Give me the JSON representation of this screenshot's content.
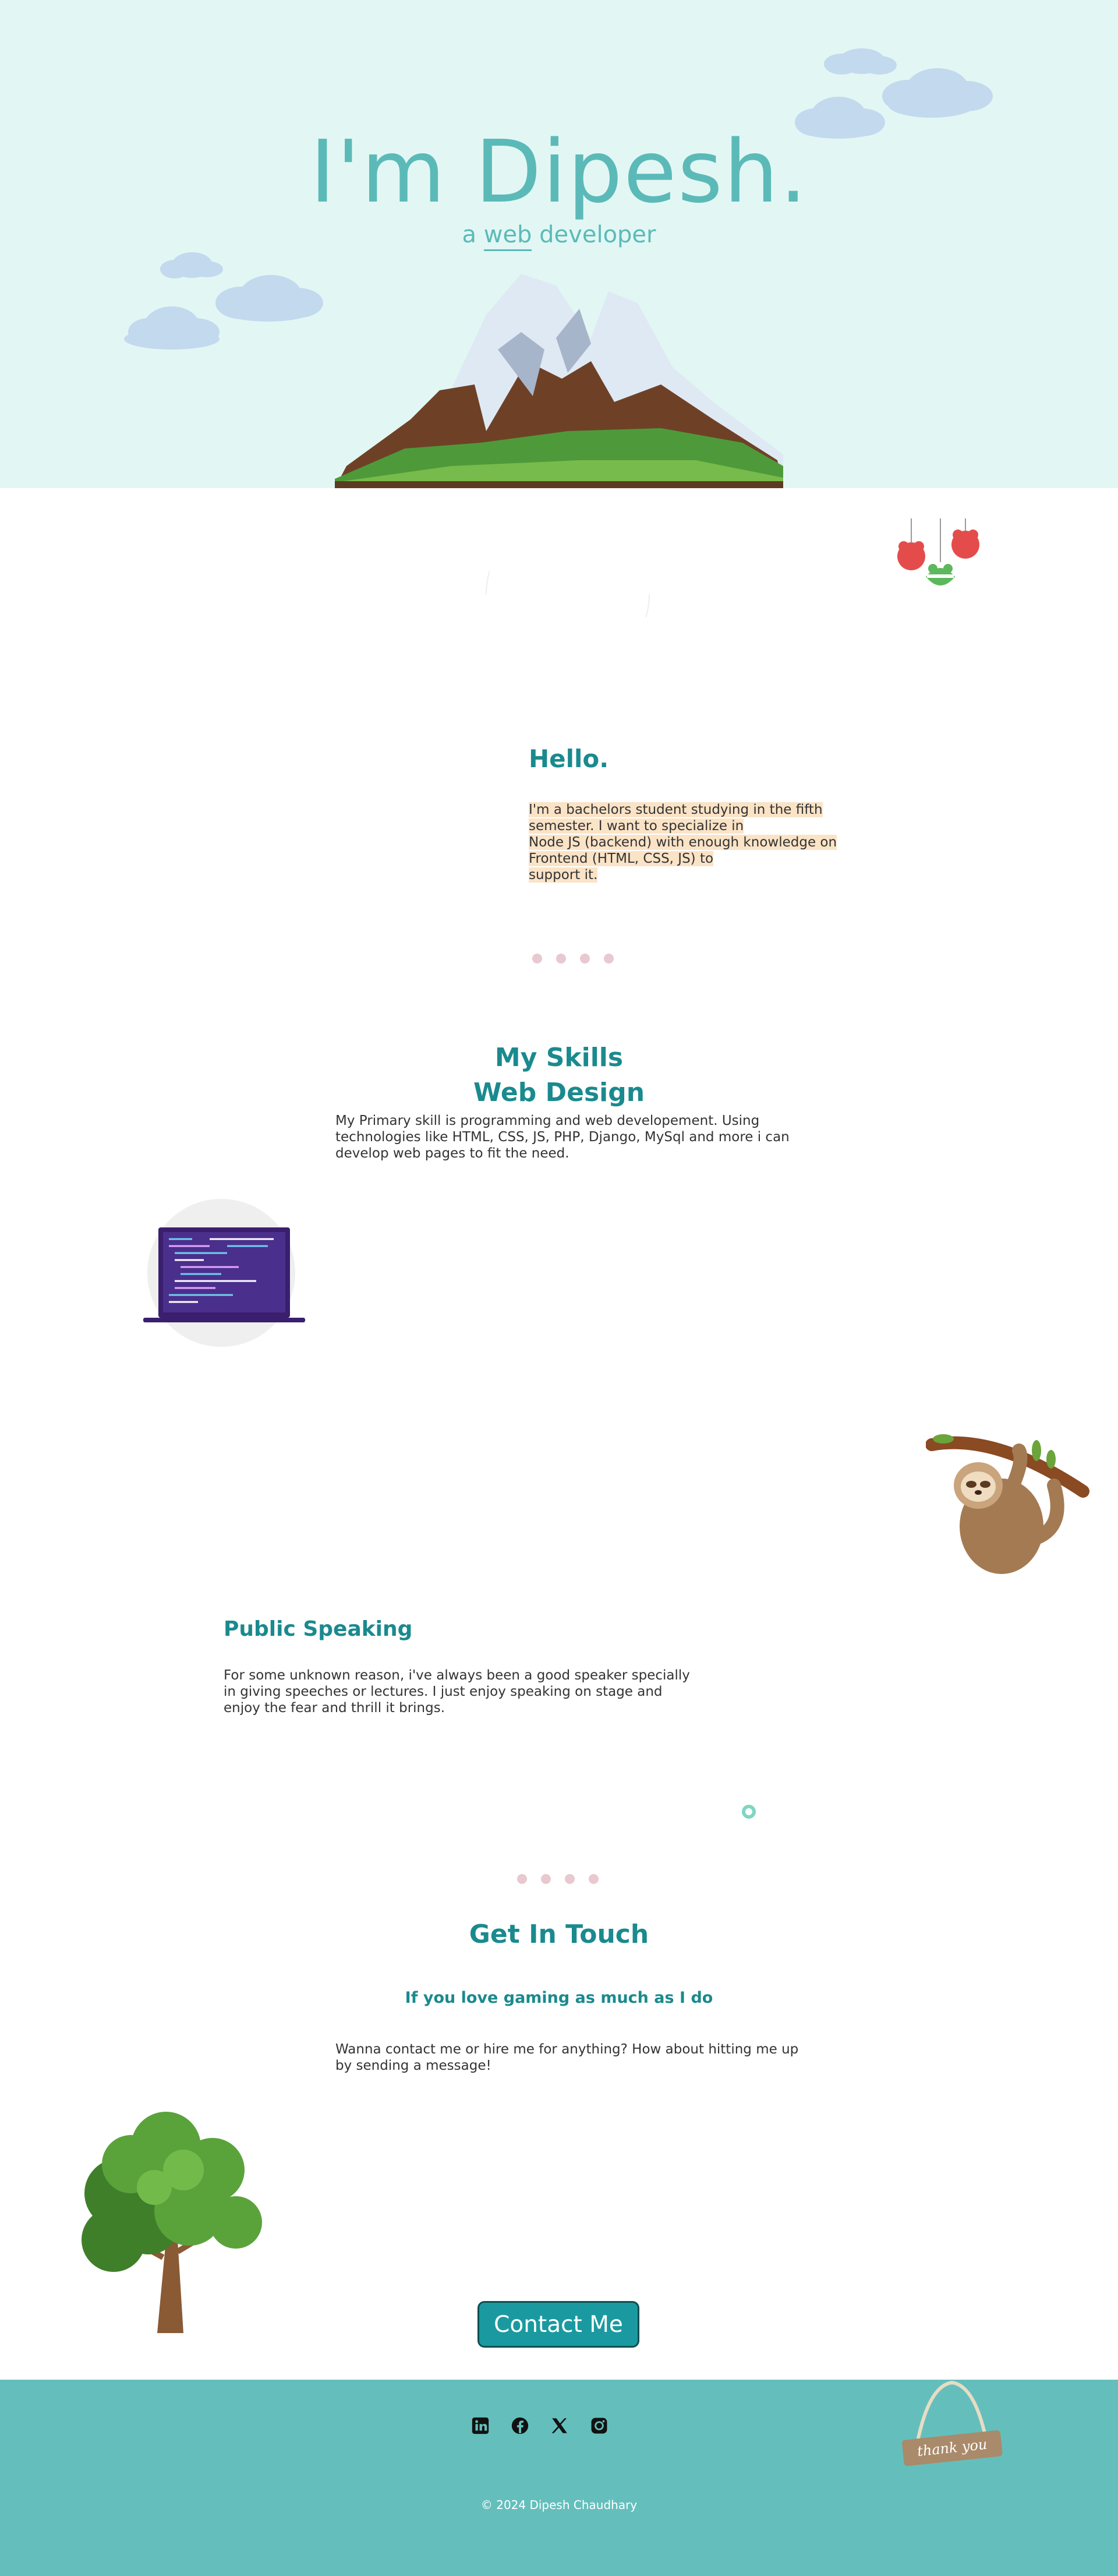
{
  "hero": {
    "title": "I'm Dipesh.",
    "subtitle_prefix": "a ",
    "subtitle_highlight": "web",
    "subtitle_suffix": " developer"
  },
  "about": {
    "heading": "Hello.",
    "text_lines": [
      "I'm a bachelors student studying in the fifth",
      "semester. I want to specialize in",
      "Node JS (backend) with enough knowledge on",
      "Frontend (HTML, CSS, JS) to",
      "support it."
    ]
  },
  "skills": {
    "heading": "My Skills",
    "web": {
      "title": "Web Design",
      "text_lines": [
        "My Primary skill is programming and web developement. Using",
        "technologies like HTML, CSS, JS, PHP, Django, MySql and more i can",
        "develop web pages to fit the need."
      ]
    },
    "speaking": {
      "title": "Public Speaking",
      "text_lines": [
        "For some unknown reason, i've always been a good speaker specially",
        "in giving speeches or lectures. I just enjoy speaking on stage and",
        "enjoy the fear and thrill it brings."
      ]
    }
  },
  "contact": {
    "heading": "Get In Touch",
    "subheading": "If you love gaming as much as I do",
    "text_lines": [
      "Wanna contact me or hire me for anything? How about hitting me up",
      "by sending a message!"
    ],
    "button_label": "Contact Me"
  },
  "footer": {
    "social_icons": [
      "linkedin-icon",
      "facebook-icon",
      "x-icon",
      "instagram-icon"
    ],
    "copyright": "© 2024 Dipesh Chaudhary",
    "sign_text": "thank you"
  },
  "colors": {
    "hero_bg": "#e2f7f4",
    "accent": "#1a8a8e",
    "footer_bg": "#64bfbc",
    "button_bg": "#1a9aa0"
  }
}
